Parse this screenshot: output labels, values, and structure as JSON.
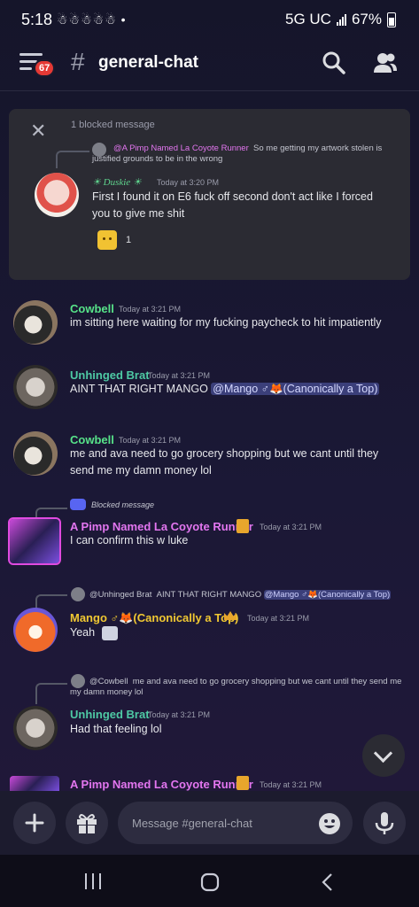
{
  "status": {
    "time": "5:18",
    "notifications": "☃☃☃☃☃ •",
    "network": "5G UC",
    "battery": "67%"
  },
  "header": {
    "unread_count": "67",
    "hash": "#",
    "channel": "general-chat"
  },
  "blocked_card": {
    "label": "1 blocked message",
    "reply": {
      "name": "@A Pimp Named La Coyote Runner",
      "text": "So me getting my artwork stolen is justified grounds to be in the wrong"
    },
    "author": "Duskie",
    "time": "Today at 3:20 PM",
    "text": "First I found it on E6 fuck off second don't act like I forced you to give me shit",
    "reaction_count": "1"
  },
  "messages": [
    {
      "name": "Cowbell",
      "time": "Today at 3:21 PM",
      "text": "im sitting here waiting for my fucking paycheck to hit impatiently"
    },
    {
      "name": "Unhinged Brat",
      "time": "Today at 3:21 PM",
      "text": "AINT THAT RIGHT MANGO ",
      "mention": "@Mango ♂🦊(Canonically a Top)"
    },
    {
      "name": "Cowbell",
      "time": "Today at 3:21 PM",
      "text": "me and ava need to go grocery shopping but we cant until they send me my damn money lol"
    },
    {
      "blocked_label": "Blocked message",
      "name": "A Pimp Named La Coyote Runner",
      "time": "Today at 3:21 PM",
      "text": "I can confirm this w luke"
    },
    {
      "reply_name": "@Unhinged Brat",
      "reply_text": "AINT THAT RIGHT MANGO ",
      "reply_mention": "@Mango ♂🦊(Canonically a Top)",
      "name": "Mango ♂🦊(Canonically a Top)",
      "time": "Today at 3:21 PM",
      "text": "Yeah"
    },
    {
      "reply_name": "@Cowbell",
      "reply_text": "me and ava need to go grocery shopping but we cant until they send me my damn money lol",
      "name": "Unhinged Brat",
      "time": "Today at 3:21 PM",
      "text": "Had that feeling lol"
    },
    {
      "name": "A Pimp Named La Coyote Runner",
      "time": "Today at 3:21 PM"
    }
  ],
  "composer": {
    "placeholder": "Message #general-chat"
  },
  "colors": {
    "cowbell": "#57e389",
    "unhinged": "#4ec9a4",
    "pimp": "#e376f0",
    "mango": "#f0c832",
    "blurple": "#5865f2"
  },
  "icons": [
    "menu-icon",
    "search-icon",
    "members-icon",
    "close-icon",
    "plus-icon",
    "gift-icon",
    "emoji-icon",
    "mic-icon",
    "chevron-down-icon",
    "nav-recents-icon",
    "nav-home-icon",
    "nav-back-icon"
  ]
}
